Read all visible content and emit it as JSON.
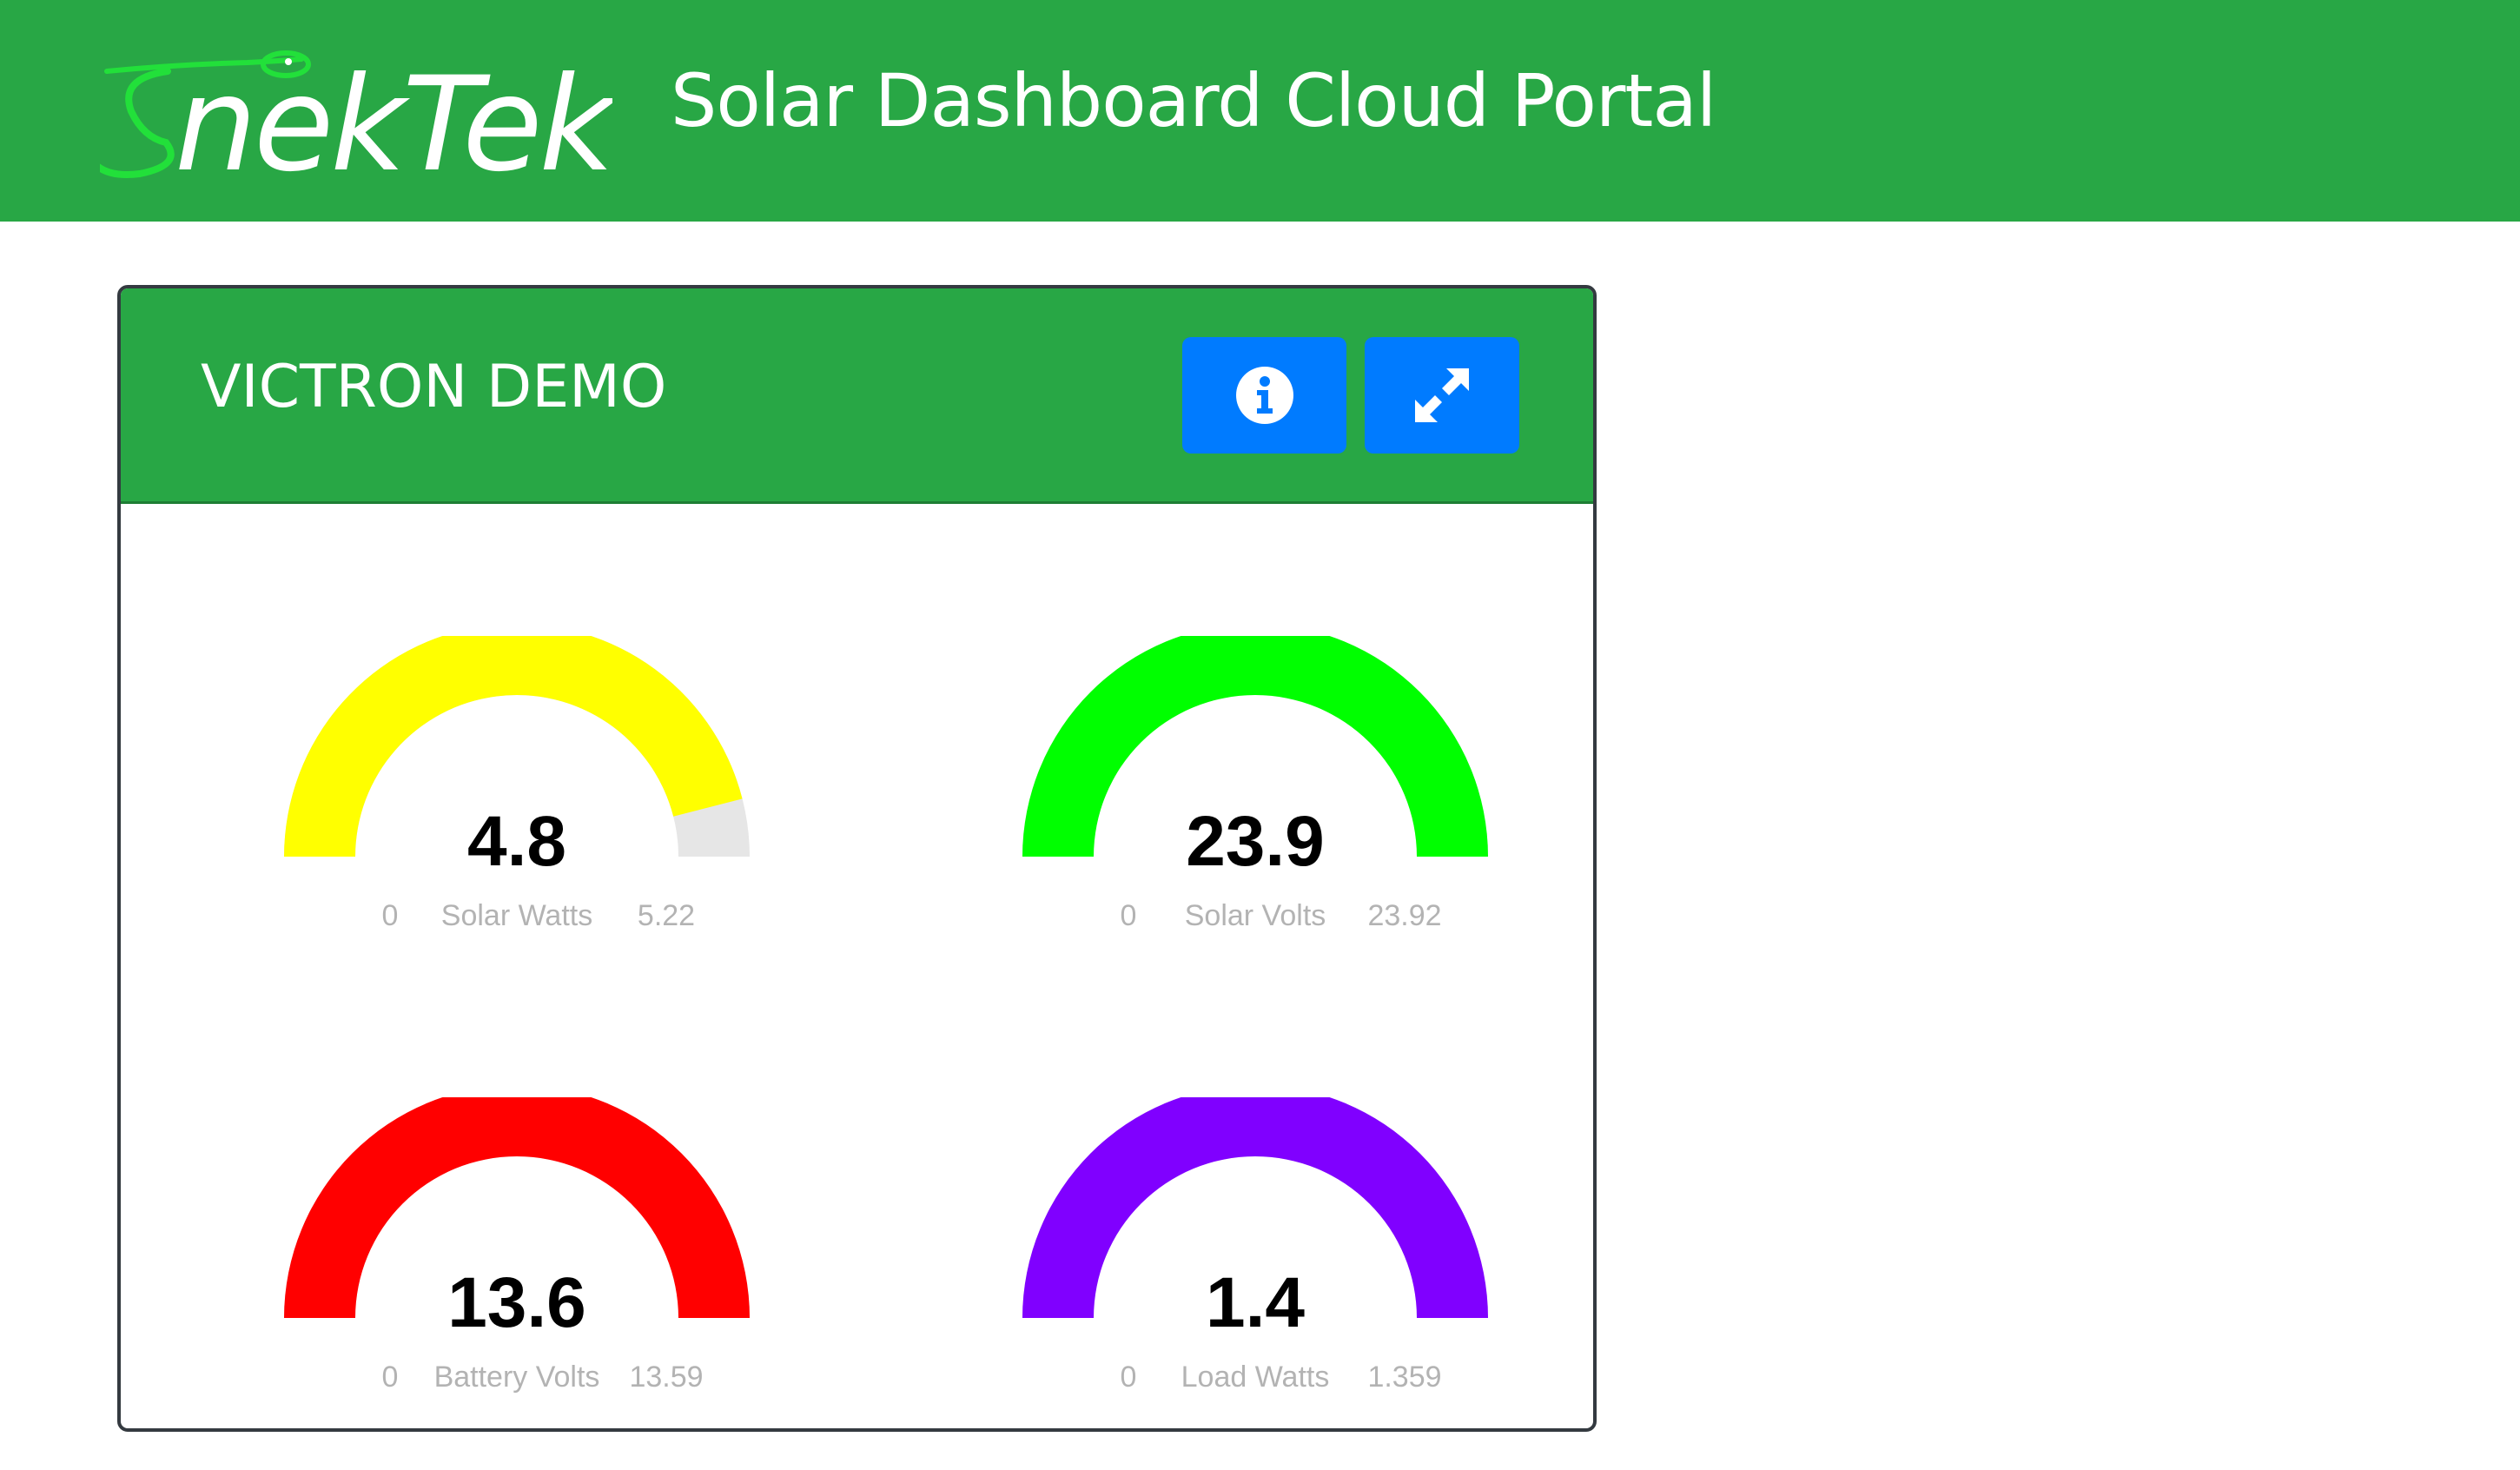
{
  "header": {
    "logo_text": "SnekTek",
    "title": "Solar Dashboard Cloud Portal"
  },
  "card": {
    "title": "VICTRON DEMO",
    "info_icon": "info-circle-icon",
    "expand_icon": "expand-arrows-icon"
  },
  "gauges": [
    {
      "value": "4.8",
      "label": "Solar Watts",
      "min": "0",
      "max": "5.22",
      "fraction": 0.92,
      "color": "#ffff00"
    },
    {
      "value": "23.9",
      "label": "Solar Volts",
      "min": "0",
      "max": "23.92",
      "fraction": 1.0,
      "color": "#00ff00"
    },
    {
      "value": "13.6",
      "label": "Battery Volts",
      "min": "0",
      "max": "13.59",
      "fraction": 1.0,
      "color": "#ff0000"
    },
    {
      "value": "1.4",
      "label": "Load Watts",
      "min": "0",
      "max": "1.359",
      "fraction": 1.0,
      "color": "#8000ff"
    }
  ],
  "colors": {
    "brand_green": "#28a745",
    "button_blue": "#007bff",
    "gauge_track": "#e6e6e6"
  }
}
